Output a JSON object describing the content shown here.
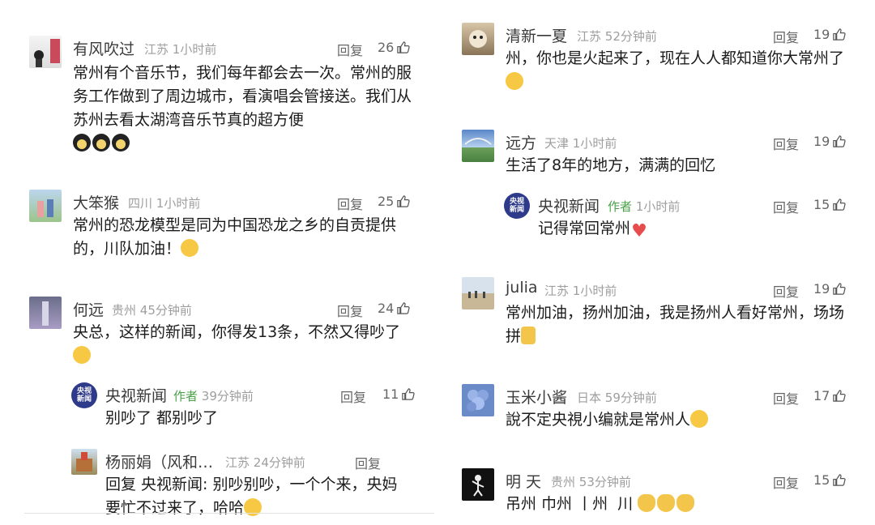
{
  "reply_label": "回复",
  "left": [
    {
      "name": "有风吹过",
      "region": "江苏",
      "time": "1小时前",
      "likes": "26",
      "text": "常州有个音乐节，我们每年都会去一次。常州的服务工作做到了周边城市，看演唱会管接送。我们从苏州去看太湖湾音乐节真的超方便"
    },
    {
      "name": "大笨猴",
      "region": "四川",
      "time": "1小时前",
      "likes": "25",
      "text": "常州的恐龙模型是同为中国恐龙之乡的自贡提供的，川队加油！"
    },
    {
      "name": "何远",
      "region": "贵州",
      "time": "45分钟前",
      "likes": "24",
      "text": "央总，这样的新闻，你得发13条，不然又得吵了"
    },
    {
      "name": "央视新闻",
      "tag": "作者",
      "time": "39分钟前",
      "likes": "11",
      "text": "别吵了 都别吵了",
      "logo": "央视\n新闻"
    },
    {
      "name": "杨丽娟（风和…",
      "region": "江苏",
      "time": "24分钟前",
      "text": "回复 央视新闻: 别吵别吵，一个个来，央妈要忙不过来了，哈哈"
    }
  ],
  "right": [
    {
      "name": "清新一夏",
      "region": "江苏",
      "time": "52分钟前",
      "likes": "19",
      "text": "州，你也是火起来了，现在人人都知道你大常州了"
    },
    {
      "name": "远方",
      "region": "天津",
      "time": "1小时前",
      "likes": "19",
      "text": "生活了8年的地方，满满的回忆"
    },
    {
      "name": "央视新闻",
      "tag": "作者",
      "time": "1小时前",
      "likes": "15",
      "text": "记得常回常州",
      "logo": "央视\n新闻"
    },
    {
      "name": "julia",
      "region": "江苏",
      "time": "1小时前",
      "likes": "19",
      "text": "常州加油，扬州加油，我是扬州人看好常州，场场拼"
    },
    {
      "name": "玉米小酱",
      "region": "日本",
      "time": "59分钟前",
      "likes": "17",
      "text": "說不定央視小编就是常州人"
    },
    {
      "name": "明 天",
      "region": "贵州",
      "time": "53分钟前",
      "likes": "15",
      "text": "吊州 巾州 丨州  川"
    }
  ],
  "colors": {
    "author_tag": "#4aa14a",
    "meta": "#9e9e9e",
    "cctv_logo": "#2e3a8a"
  }
}
